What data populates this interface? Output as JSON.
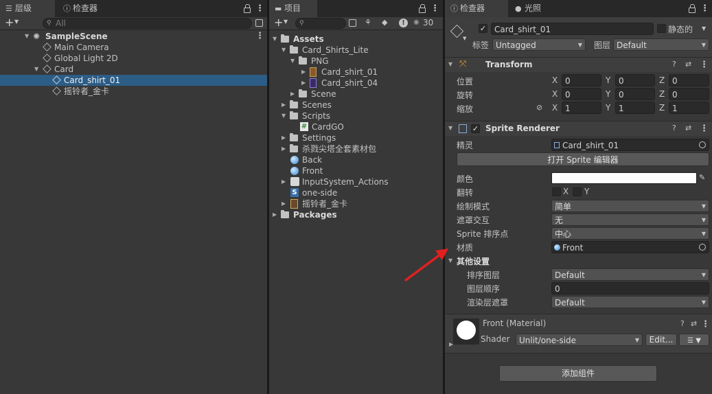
{
  "hierarchy": {
    "tab_label": "层级",
    "inspector_tab_label": "检查器",
    "search_placeholder": "All",
    "scene_name": "SampleScene",
    "items": [
      {
        "label": "Main Camera"
      },
      {
        "label": "Global Light 2D"
      },
      {
        "label": "Card"
      },
      {
        "label": "Card_shirt_01"
      },
      {
        "label": "摇铃者_金卡"
      }
    ]
  },
  "project": {
    "tab_label": "项目",
    "hidden_count": "30",
    "tree": [
      {
        "label": "Assets"
      },
      {
        "label": "Card_Shirts_Lite"
      },
      {
        "label": "PNG"
      },
      {
        "label": "Card_shirt_01"
      },
      {
        "label": "Card_shirt_04"
      },
      {
        "label": "Scene"
      },
      {
        "label": "Scenes"
      },
      {
        "label": "Scripts"
      },
      {
        "label": "CardGO"
      },
      {
        "label": "Settings"
      },
      {
        "label": "杀戮尖塔全套素材包"
      },
      {
        "label": "Back"
      },
      {
        "label": "Front"
      },
      {
        "label": "InputSystem_Actions"
      },
      {
        "label": "one-side"
      },
      {
        "label": "摇铃者_金卡"
      },
      {
        "label": "Packages"
      }
    ]
  },
  "inspector": {
    "tab_label": "检查器",
    "lighting_tab_label": "光照",
    "object_name": "Card_shirt_01",
    "static_label": "静态的",
    "tag_label": "标签",
    "tag_value": "Untagged",
    "layer_label": "图层",
    "layer_value": "Default",
    "transform": {
      "title": "Transform",
      "position_label": "位置",
      "rotation_label": "旋转",
      "scale_label": "缩放",
      "axis_x": "X",
      "axis_y": "Y",
      "axis_z": "Z",
      "position": [
        "0",
        "0",
        "0"
      ],
      "rotation": [
        "0",
        "0",
        "0"
      ],
      "scale": [
        "1",
        "1",
        "1"
      ]
    },
    "sprite_renderer": {
      "title": "Sprite Renderer",
      "sprite_label": "精灵",
      "sprite_value": "Card_shirt_01",
      "open_editor_button": "打开 Sprite 编辑器",
      "color_label": "颜色",
      "color_value": "#ffffff",
      "flip_label": "翻转",
      "flip_x": "X",
      "flip_y": "Y",
      "draw_mode_label": "绘制模式",
      "draw_mode_value": "简单",
      "mask_label": "遮罩交互",
      "mask_value": "无",
      "sort_point_label": "Sprite 排序点",
      "sort_point_value": "中心",
      "material_label": "材质",
      "material_value": "Front",
      "additional_label": "其他设置",
      "sorting_layer_label": "排序图层",
      "sorting_layer_value": "Default",
      "order_label": "图层顺序",
      "order_value": "0",
      "rendering_mask_label": "渲染层遮罩",
      "rendering_mask_value": "Default"
    },
    "material": {
      "title": "Front (Material)",
      "shader_label": "Shader",
      "shader_value": "Unlit/one-side",
      "edit_button": "Edit..."
    },
    "add_component_button": "添加组件"
  },
  "colors": {
    "selection": "#2c5d87",
    "arrow": "#e02020",
    "panel_bg": "#383838"
  }
}
